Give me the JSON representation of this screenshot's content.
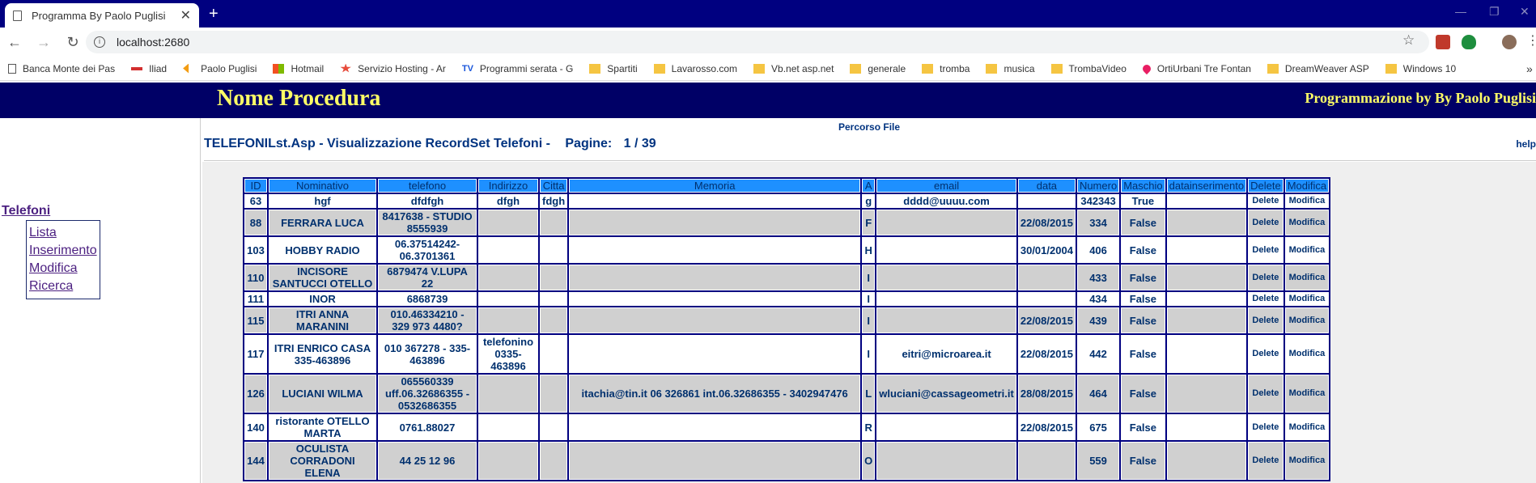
{
  "browser": {
    "tab_title": "Programma By Paolo Puglisi",
    "url": "localhost:2680",
    "bookmarks": [
      {
        "label": "Banca Monte dei Pas",
        "icon": "page-icon"
      },
      {
        "label": "Iliad",
        "icon": "iliad-icon"
      },
      {
        "label": "Paolo Puglisi",
        "icon": "arrows-icon"
      },
      {
        "label": "Hotmail",
        "icon": "windows-icon"
      },
      {
        "label": "Servizio Hosting - Ar",
        "icon": "star-icon"
      },
      {
        "label": "Programmi serata - G",
        "icon": "tv-icon"
      },
      {
        "label": "Spartiti",
        "icon": "folder-icon"
      },
      {
        "label": "Lavarosso.com",
        "icon": "folder-icon"
      },
      {
        "label": "Vb.net asp.net",
        "icon": "folder-icon"
      },
      {
        "label": "generale",
        "icon": "folder-icon"
      },
      {
        "label": "tromba",
        "icon": "folder-icon"
      },
      {
        "label": "musica",
        "icon": "folder-icon"
      },
      {
        "label": "TrombaVideo",
        "icon": "folder-icon"
      },
      {
        "label": "OrtiUrbani Tre Fontan",
        "icon": "heart-icon"
      },
      {
        "label": "DreamWeaver ASP",
        "icon": "folder-icon"
      },
      {
        "label": "Windows 10",
        "icon": "folder-icon"
      }
    ],
    "more_bookmarks": "»"
  },
  "banner": {
    "procedure": "Nome Procedura",
    "author": "Programmazione by By Paolo Puglisi"
  },
  "sidebar": {
    "heading": "Telefoni",
    "items": [
      "Lista",
      "Inserimento",
      "Modifica",
      "Ricerca"
    ]
  },
  "main": {
    "percorso": "Percorso File",
    "title": "TELEFONILst.Asp - Visualizzazione RecordSet Telefoni -",
    "pages_label": "Pagine:",
    "pages_value": "1 / 39",
    "help": "help"
  },
  "table": {
    "headers": [
      "ID",
      "Nominativo",
      "telefono",
      "Indirizzo",
      "Citta",
      "Memoria",
      "A",
      "email",
      "data",
      "Numero",
      "Maschio",
      "datainserimento",
      "Delete",
      "Modifica"
    ],
    "rows": [
      [
        "63",
        "hgf",
        "dfdfgh",
        "dfgh",
        "fdgh",
        "",
        "g",
        "dddd@uuuu.com",
        "",
        "342343",
        "True",
        "",
        "Delete",
        "Modifica"
      ],
      [
        "88",
        "FERRARA LUCA",
        "8417638 - STUDIO 8555939",
        "",
        "",
        "",
        "F",
        "",
        "22/08/2015",
        "334",
        "False",
        "",
        "Delete",
        "Modifica"
      ],
      [
        "103",
        "HOBBY RADIO",
        "06.37514242- 06.3701361",
        "",
        "",
        "",
        "H",
        "",
        "30/01/2004",
        "406",
        "False",
        "",
        "Delete",
        "Modifica"
      ],
      [
        "110",
        "INCISORE SANTUCCI OTELLO",
        "6879474 V.LUPA 22",
        "",
        "",
        "",
        "I",
        "",
        "",
        "433",
        "False",
        "",
        "Delete",
        "Modifica"
      ],
      [
        "111",
        "INOR",
        "6868739",
        "",
        "",
        "",
        "I",
        "",
        "",
        "434",
        "False",
        "",
        "Delete",
        "Modifica"
      ],
      [
        "115",
        "ITRI ANNA MARANINI",
        "010.46334210 - 329 973 4480?",
        "",
        "",
        "",
        "I",
        "",
        "22/08/2015",
        "439",
        "False",
        "",
        "Delete",
        "Modifica"
      ],
      [
        "117",
        "ITRI ENRICO CASA 335-463896",
        "010 367278 - 335-463896",
        "telefonino 0335-463896",
        "",
        "",
        "I",
        "eitri@microarea.it",
        "22/08/2015",
        "442",
        "False",
        "",
        "Delete",
        "Modifica"
      ],
      [
        "126",
        "LUCIANI WILMA",
        "065560339 uff.06.32686355 - 0532686355",
        "",
        "",
        "itachia@tin.it 06 326861 int.06.32686355 - 3402947476",
        "L",
        "wluciani@cassageometri.it",
        "28/08/2015",
        "464",
        "False",
        "",
        "Delete",
        "Modifica"
      ],
      [
        "140",
        "ristorante OTELLO MARTA",
        "0761.88027",
        "",
        "",
        "",
        "R",
        "",
        "22/08/2015",
        "675",
        "False",
        "",
        "Delete",
        "Modifica"
      ],
      [
        "144",
        "OCULISTA CORRADONI ELENA",
        "44 25 12 96",
        "",
        "",
        "",
        "O",
        "",
        "",
        "559",
        "False",
        "",
        "Delete",
        "Modifica"
      ]
    ]
  }
}
